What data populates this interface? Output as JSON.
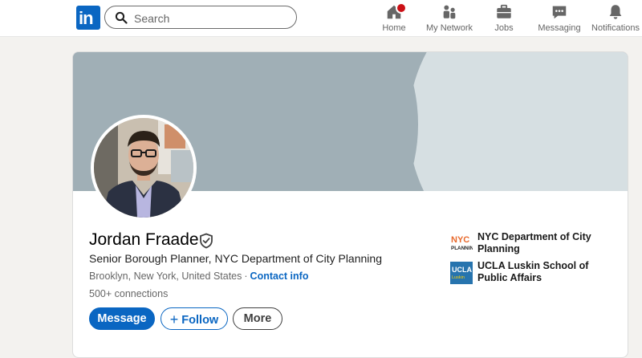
{
  "nav": {
    "search_placeholder": "Search",
    "items": [
      {
        "label": "Home",
        "icon": "home-icon"
      },
      {
        "label": "My Network",
        "icon": "network-icon"
      },
      {
        "label": "Jobs",
        "icon": "briefcase-icon"
      },
      {
        "label": "Messaging",
        "icon": "messaging-icon"
      },
      {
        "label": "Notifications",
        "icon": "bell-icon"
      }
    ]
  },
  "profile": {
    "name": "Jordan Fraade",
    "headline": "Senior Borough Planner, NYC Department of City Planning",
    "location": "Brooklyn, New York, United States",
    "separator": "·",
    "contact_info": "Contact info",
    "connections": "500+ connections"
  },
  "actions": {
    "message": "Message",
    "follow": "Follow",
    "more": "More"
  },
  "experience": [
    {
      "name": "NYC Department of City Planning",
      "logo_text": "NYC PLANNING",
      "logo_color": "#e8692c"
    },
    {
      "name": "UCLA Luskin School of Public Affairs",
      "logo_text": "UCLA Luskin",
      "logo_color": "#2774ae"
    }
  ],
  "colors": {
    "brand": "#0a66c2",
    "badge": "#cc1016",
    "cover": "#a0afb6"
  }
}
